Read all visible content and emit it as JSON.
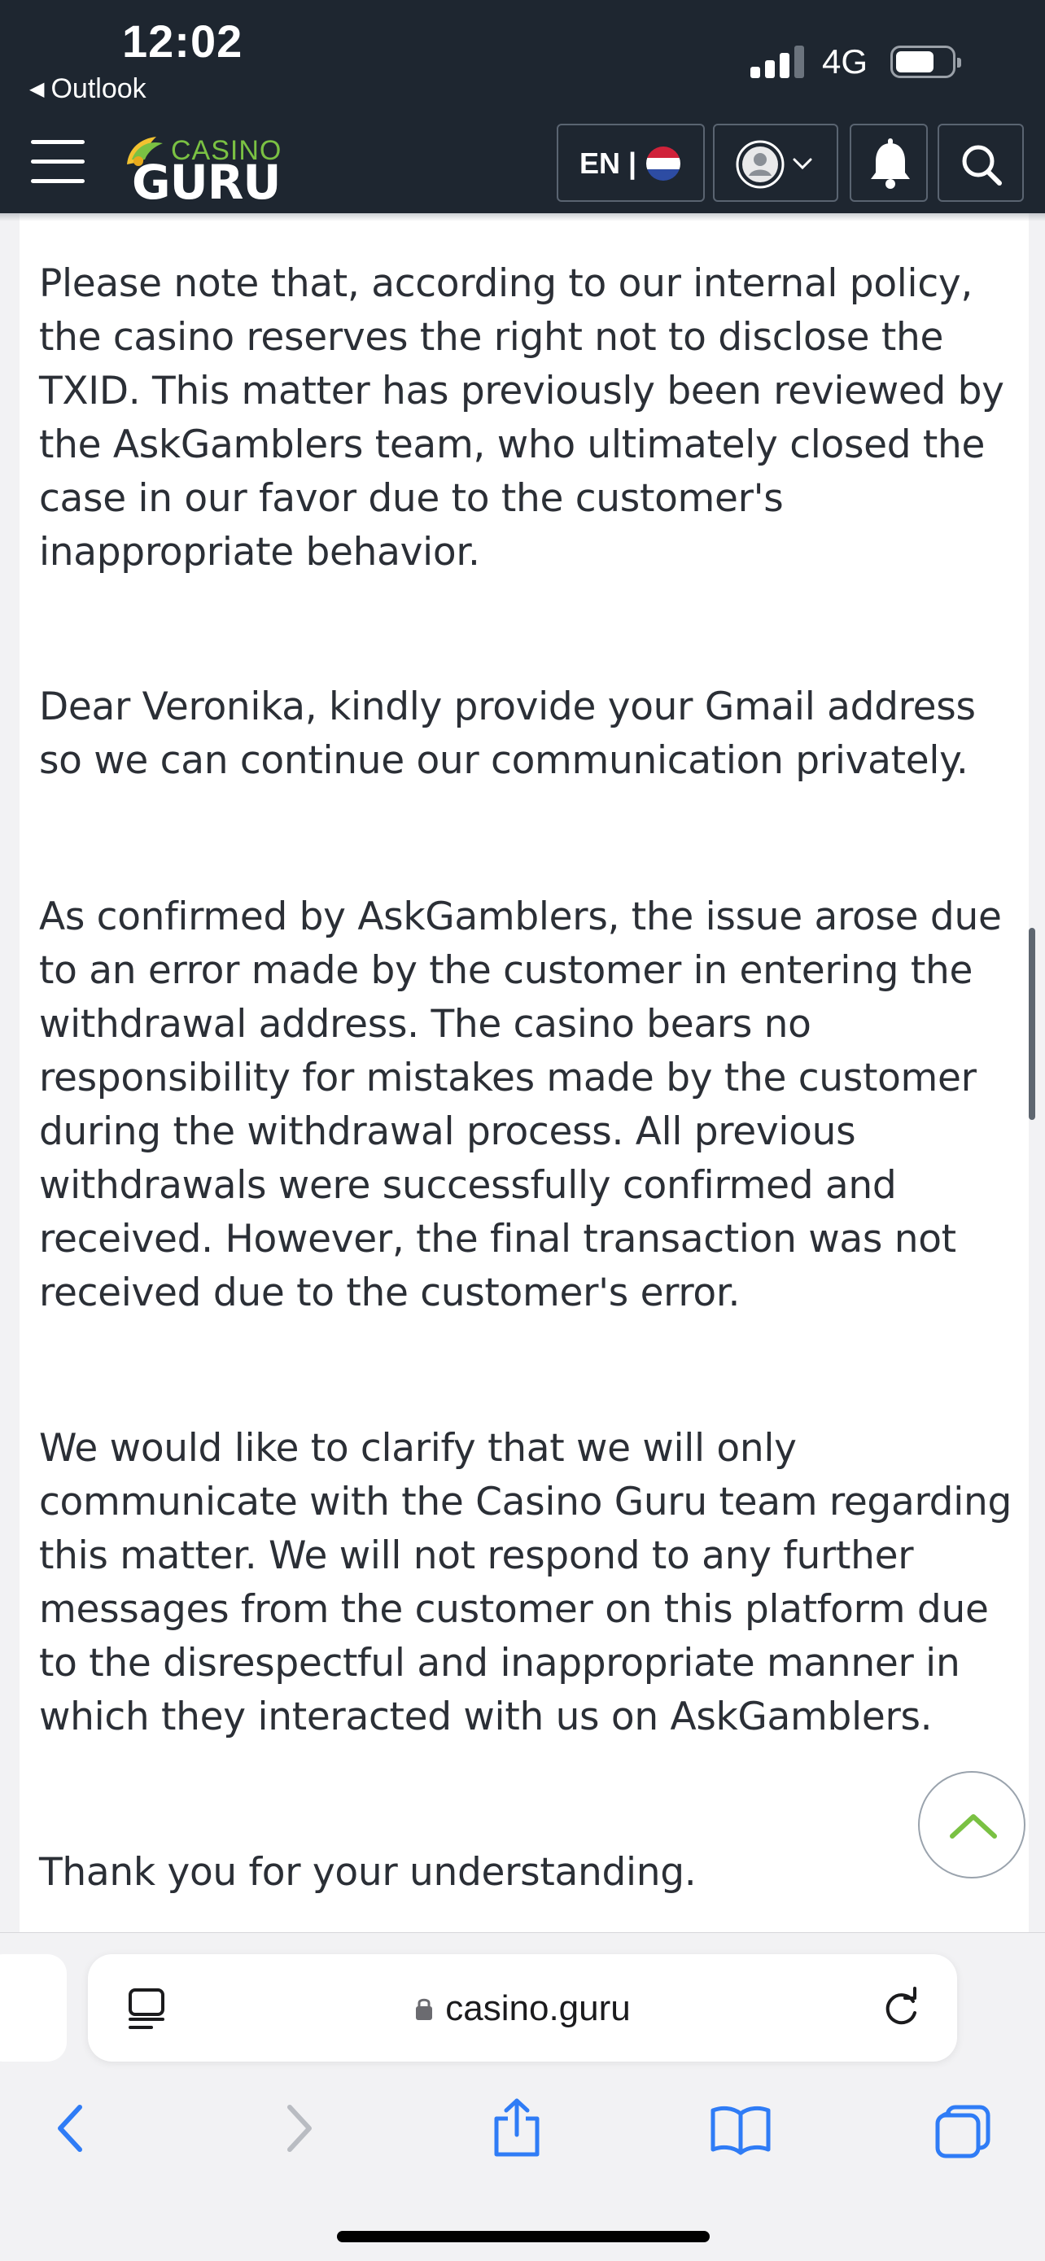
{
  "status_bar": {
    "time": "12:02",
    "back_app": "Outlook",
    "network": "4G",
    "signal_bars": 3,
    "battery_level": 0.6
  },
  "header": {
    "logo_small": "CASINO",
    "logo_big": "GURU",
    "language": "EN |",
    "colors": {
      "background": "#1e2630",
      "accent": "#7ac143"
    }
  },
  "content": {
    "paragraphs": [
      "Please note that, according to our internal policy, the casino reserves the right not to disclose the TXID. This matter has previously been reviewed by the AskGamblers team, who ultimately closed the case in our favor due to the customer's inappropriate behavior.",
      "Dear Veronika, kindly provide your Gmail address so we can continue our communication privately.",
      "As confirmed by AskGamblers, the issue arose due to an error made by the customer in entering the withdrawal address. The casino bears no responsibility for mistakes made by the customer during the withdrawal process. All previous withdrawals were successfully confirmed and received. However, the final transaction was not received due to the customer's error.",
      "We would like to clarify that we will only communicate with the Casino Guru team regarding this matter. We will not respond to any further messages from the customer on this platform due to the disrespectful and inappropriate manner in which they interacted with us on AskGamblers.",
      "Thank you for your understanding."
    ]
  },
  "browser": {
    "url": "casino.guru",
    "toolbar_icons": [
      "back-icon",
      "forward-icon",
      "share-icon",
      "bookmarks-icon",
      "tabs-icon"
    ]
  }
}
